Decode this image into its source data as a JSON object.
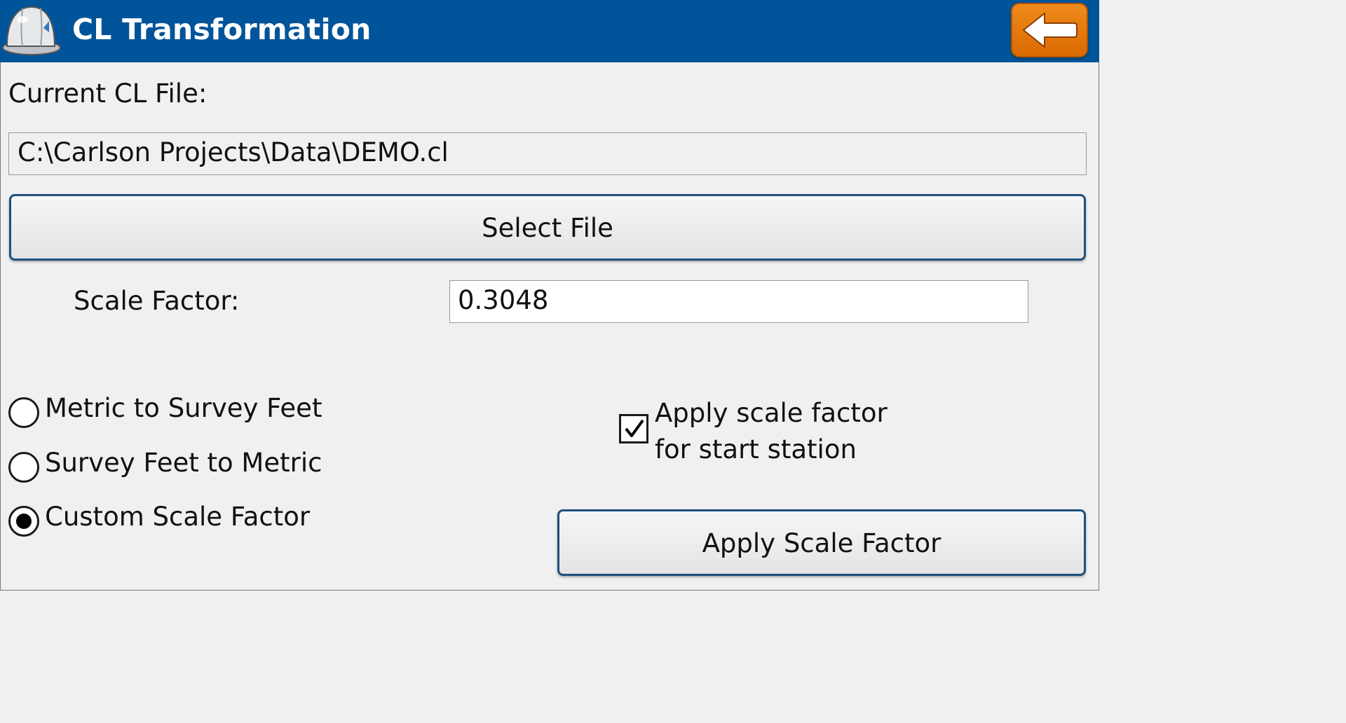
{
  "header": {
    "title": "CL Transformation",
    "logo_icon": "hard-hat-icon",
    "back_icon": "arrow-left-icon",
    "accent": "#00549a",
    "back_color": "#e87a10"
  },
  "file": {
    "label": "Current CL File:",
    "path": "C:\\Carlson Projects\\Data\\DEMO.cl",
    "select_label": "Select File"
  },
  "scale": {
    "label": "Scale Factor:",
    "value": "0.3048"
  },
  "options": [
    {
      "label": "Metric to Survey Feet",
      "selected": false
    },
    {
      "label": "Survey Feet to Metric",
      "selected": false
    },
    {
      "label": "Custom Scale Factor",
      "selected": true
    }
  ],
  "start_station": {
    "line1": "Apply scale factor",
    "line2": "for start station",
    "checked": true
  },
  "apply_label": "Apply Scale Factor"
}
